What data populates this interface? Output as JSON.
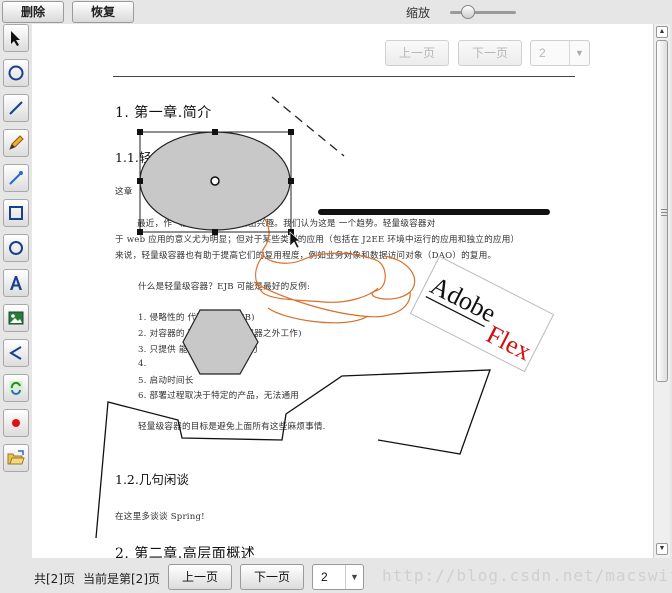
{
  "top_bar": {
    "delete_label": "删除",
    "restore_label": "恢复",
    "zoom_label": "缩放"
  },
  "toolbar": {
    "tools": [
      "select-arrow-icon",
      "circle-icon",
      "line-icon",
      "pencil-icon",
      "brush-icon",
      "rectangle-icon",
      "ellipse-icon",
      "text-icon",
      "image-icon",
      "arrow-left-icon",
      "refresh-icon",
      "record-icon",
      "open-folder-icon"
    ]
  },
  "document": {
    "pager": {
      "prev_label": "上一页",
      "next_label": "下一页",
      "page_value": "2"
    },
    "heading_1": "1. 第一章.简介",
    "heading_1_1": "1.1.轻",
    "para_intro": "这章",
    "para_1_line1": "最近，作                              \"轻量级容器\" 表现出兴趣。我们认为这是 一个趋势。轻量级容器对",
    "para_1_line2": "于 web 应用的意义尤为明显；但对于某些类型的应用（包括在 J2EE 环境中运行的应用和独立的应用）",
    "para_1_line3": "来说，轻量级容器也有助于提高它们的复用程度，例如业务对象和数据访问对象（DAO）的复用。",
    "question": "什么是轻量级容器？EJB 可能是最好的反例:",
    "list": [
      "1.  侵略性的           代码依赖于 EJB)",
      "2.  对容器的           码不能在 EJB 容器之外工作)",
      "3.  只提供             能，不具备配置能力",
      "4.",
      "5.  启动时间长",
      "6.  部署过程取决于特定的产品，无法通用"
    ],
    "conclusion": "轻量级容器的目标是避免上面所有这些麻烦事情.",
    "heading_1_2": "1.2.几句闲谈",
    "para_spring": "在这里多谈谈 Spring!",
    "heading_2": "2. 第二章.高层面概述",
    "logo_text_1": "Adobe",
    "logo_text_2": "Flex"
  },
  "bottom_bar": {
    "total_pages": "共[2]页",
    "current_page": "当前是第[2]页",
    "prev_label": "上一页",
    "next_label": "下一页",
    "page_value": "2",
    "watermark": "http://blog.csdn.net/macswift"
  }
}
